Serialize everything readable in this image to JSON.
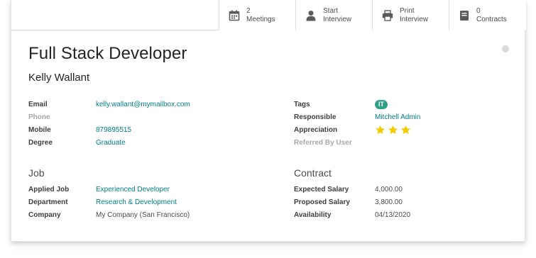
{
  "smart_buttons": [
    {
      "line1": "2",
      "line2": "Meetings",
      "icon": "calendar-icon"
    },
    {
      "line1": "Start",
      "line2": "Interview",
      "icon": "user-icon"
    },
    {
      "line1": "Print",
      "line2": "Interview",
      "icon": "printer-icon"
    },
    {
      "line1": "0",
      "line2": "Contracts",
      "icon": "book-icon"
    }
  ],
  "header": {
    "title": "Full Stack Developer",
    "applicant_name": "Kelly Wallant"
  },
  "left_fields": [
    {
      "label": "Email",
      "value": "kelly.wallant@mymailbox.com"
    },
    {
      "label": "Phone",
      "value": ""
    },
    {
      "label": "Mobile",
      "value": "879895515"
    },
    {
      "label": "Degree",
      "value": "Graduate"
    }
  ],
  "right_fields": {
    "tags_label": "Tags",
    "tag": "IT",
    "responsible_label": "Responsible",
    "responsible": "Mitchell Admin",
    "appreciation_label": "Appreciation",
    "appreciation_stars": 3,
    "appreciation_max": 3,
    "referred_label": "Referred By User",
    "referred": ""
  },
  "job_section": {
    "title": "Job",
    "fields": [
      {
        "label": "Applied Job",
        "value": "Experienced Developer"
      },
      {
        "label": "Department",
        "value": "Research & Development"
      },
      {
        "label": "Company",
        "value": "My Company (San Francisco)"
      }
    ]
  },
  "contract_section": {
    "title": "Contract",
    "fields": [
      {
        "label": "Expected Salary",
        "value": "4,000.00"
      },
      {
        "label": "Proposed Salary",
        "value": "3,800.00"
      },
      {
        "label": "Availability",
        "value": "04/13/2020"
      }
    ]
  },
  "colors": {
    "link": "#017e84",
    "tag_bg": "#2fa186",
    "star": "#f3cc00",
    "status_dot": "#dadada"
  }
}
